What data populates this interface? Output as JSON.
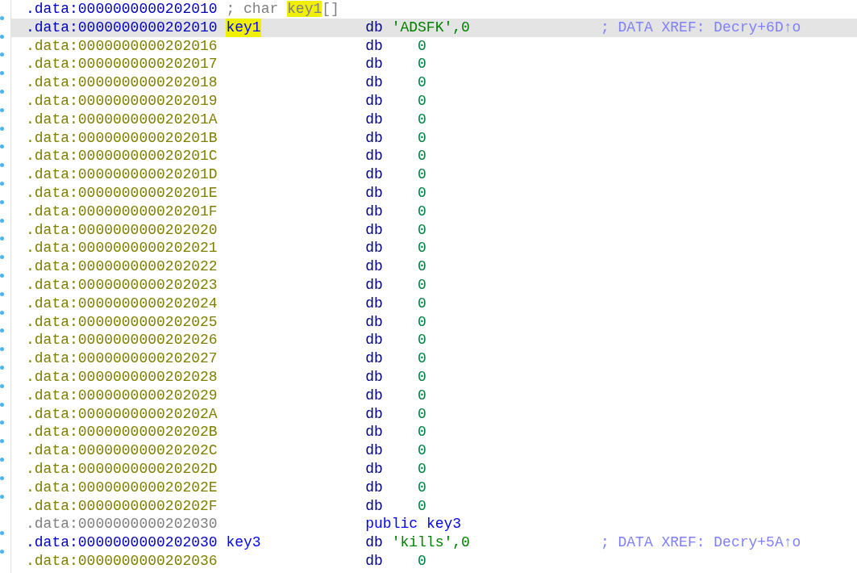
{
  "listing": {
    "rows": [
      {
        "kind": "comment",
        "address": ".data:0000000000202010",
        "comment_before": "; char ",
        "comment_name": "key1",
        "comment_after": "[]",
        "marker": false,
        "selected": false
      },
      {
        "kind": "label",
        "address": ".data:0000000000202010",
        "name": "key1",
        "name_highlighted": true,
        "mnemonic": "db",
        "operand": "'ADSFK',0",
        "xref": "; DATA XREF: Decry+6D↑o",
        "marker": true,
        "selected": true
      },
      {
        "kind": "data",
        "address": ".data:0000000000202016",
        "mnemonic": "db",
        "operand": "0",
        "marker": true,
        "selected": false
      },
      {
        "kind": "data",
        "address": ".data:0000000000202017",
        "mnemonic": "db",
        "operand": "0",
        "marker": true,
        "selected": false
      },
      {
        "kind": "data",
        "address": ".data:0000000000202018",
        "mnemonic": "db",
        "operand": "0",
        "marker": true,
        "selected": false
      },
      {
        "kind": "data",
        "address": ".data:0000000000202019",
        "mnemonic": "db",
        "operand": "0",
        "marker": true,
        "selected": false
      },
      {
        "kind": "data",
        "address": ".data:000000000020201A",
        "mnemonic": "db",
        "operand": "0",
        "marker": true,
        "selected": false
      },
      {
        "kind": "data",
        "address": ".data:000000000020201B",
        "mnemonic": "db",
        "operand": "0",
        "marker": true,
        "selected": false
      },
      {
        "kind": "data",
        "address": ".data:000000000020201C",
        "mnemonic": "db",
        "operand": "0",
        "marker": true,
        "selected": false
      },
      {
        "kind": "data",
        "address": ".data:000000000020201D",
        "mnemonic": "db",
        "operand": "0",
        "marker": true,
        "selected": false
      },
      {
        "kind": "data",
        "address": ".data:000000000020201E",
        "mnemonic": "db",
        "operand": "0",
        "marker": true,
        "selected": false
      },
      {
        "kind": "data",
        "address": ".data:000000000020201F",
        "mnemonic": "db",
        "operand": "0",
        "marker": true,
        "selected": false
      },
      {
        "kind": "data",
        "address": ".data:0000000000202020",
        "mnemonic": "db",
        "operand": "0",
        "marker": true,
        "selected": false
      },
      {
        "kind": "data",
        "address": ".data:0000000000202021",
        "mnemonic": "db",
        "operand": "0",
        "marker": true,
        "selected": false
      },
      {
        "kind": "data",
        "address": ".data:0000000000202022",
        "mnemonic": "db",
        "operand": "0",
        "marker": true,
        "selected": false
      },
      {
        "kind": "data",
        "address": ".data:0000000000202023",
        "mnemonic": "db",
        "operand": "0",
        "marker": true,
        "selected": false
      },
      {
        "kind": "data",
        "address": ".data:0000000000202024",
        "mnemonic": "db",
        "operand": "0",
        "marker": true,
        "selected": false
      },
      {
        "kind": "data",
        "address": ".data:0000000000202025",
        "mnemonic": "db",
        "operand": "0",
        "marker": true,
        "selected": false
      },
      {
        "kind": "data",
        "address": ".data:0000000000202026",
        "mnemonic": "db",
        "operand": "0",
        "marker": true,
        "selected": false
      },
      {
        "kind": "data",
        "address": ".data:0000000000202027",
        "mnemonic": "db",
        "operand": "0",
        "marker": true,
        "selected": false
      },
      {
        "kind": "data",
        "address": ".data:0000000000202028",
        "mnemonic": "db",
        "operand": "0",
        "marker": true,
        "selected": false
      },
      {
        "kind": "data",
        "address": ".data:0000000000202029",
        "mnemonic": "db",
        "operand": "0",
        "marker": true,
        "selected": false
      },
      {
        "kind": "data",
        "address": ".data:000000000020202A",
        "mnemonic": "db",
        "operand": "0",
        "marker": true,
        "selected": false
      },
      {
        "kind": "data",
        "address": ".data:000000000020202B",
        "mnemonic": "db",
        "operand": "0",
        "marker": true,
        "selected": false
      },
      {
        "kind": "data",
        "address": ".data:000000000020202C",
        "mnemonic": "db",
        "operand": "0",
        "marker": true,
        "selected": false
      },
      {
        "kind": "data",
        "address": ".data:000000000020202D",
        "mnemonic": "db",
        "operand": "0",
        "marker": true,
        "selected": false
      },
      {
        "kind": "data",
        "address": ".data:000000000020202E",
        "mnemonic": "db",
        "operand": "0",
        "marker": true,
        "selected": false
      },
      {
        "kind": "data",
        "address": ".data:000000000020202F",
        "mnemonic": "db",
        "operand": "0",
        "marker": true,
        "selected": false
      },
      {
        "kind": "directive",
        "address": ".data:0000000000202030",
        "mnemonic": "public",
        "operand": "key3",
        "marker": false,
        "selected": false
      },
      {
        "kind": "label",
        "address": ".data:0000000000202030",
        "name": "key3",
        "name_highlighted": false,
        "mnemonic": "db",
        "operand": "'kills',0",
        "xref": "; DATA XREF: Decry+5A↑o",
        "marker": true,
        "selected": false
      },
      {
        "kind": "data",
        "address": ".data:0000000000202036",
        "mnemonic": "db",
        "operand": "0",
        "marker": true,
        "selected": false
      }
    ]
  }
}
